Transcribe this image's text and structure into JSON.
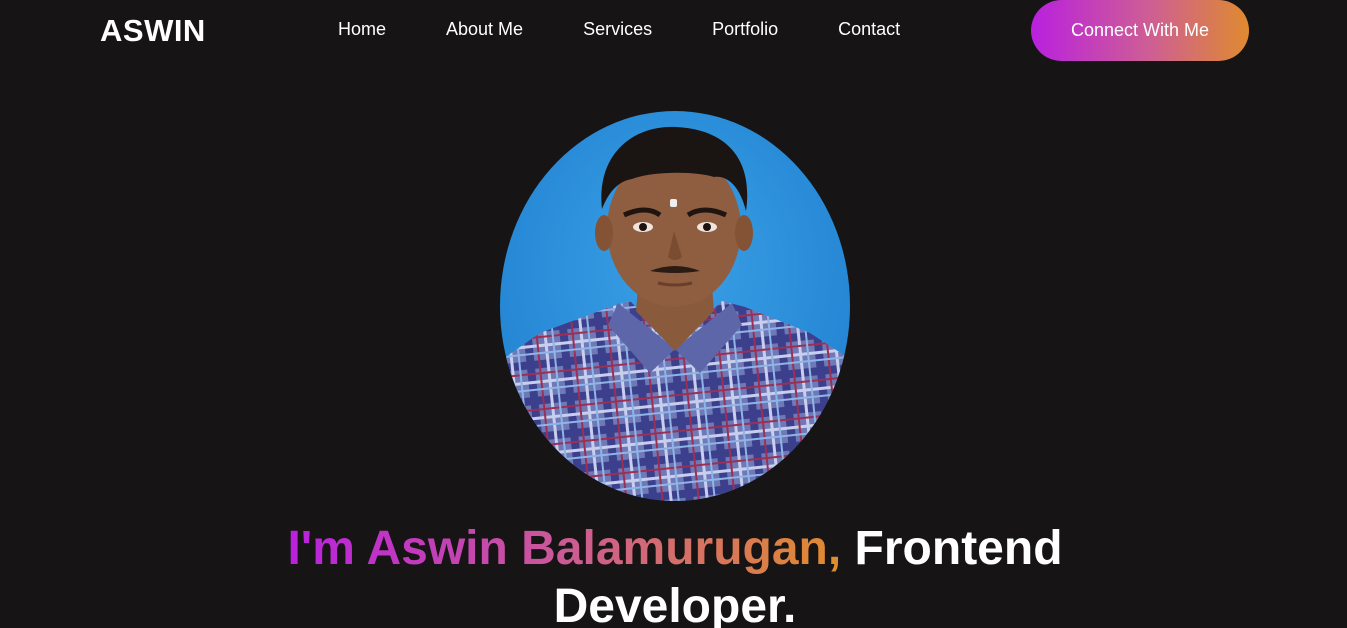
{
  "header": {
    "logo": "ASWIN",
    "nav": [
      "Home",
      "About Me",
      "Services",
      "Portfolio",
      "Contact"
    ],
    "cta": "Connect With Me"
  },
  "hero": {
    "headline_highlight": "I'm Aswin Balamurugan,",
    "headline_rest": "Frontend Developer."
  },
  "colors": {
    "background": "#161414",
    "gradient_start": "#b920df",
    "gradient_end": "#df8a2f",
    "text": "#ffffff"
  }
}
